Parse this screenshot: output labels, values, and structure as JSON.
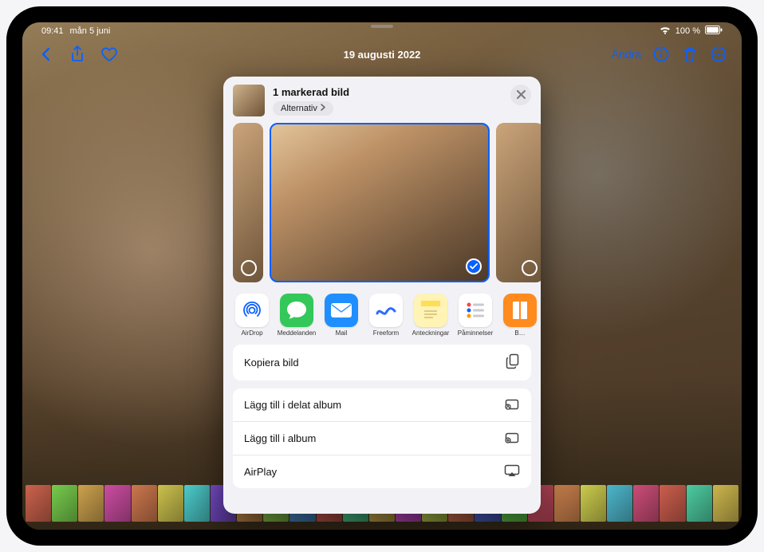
{
  "status": {
    "time": "09:41",
    "date": "mån 5 juni",
    "battery": "100 %"
  },
  "nav": {
    "title": "19 augusti 2022",
    "edit": "Ändra"
  },
  "sheet": {
    "title": "1 markerad bild",
    "options": "Alternativ",
    "apps": [
      {
        "label": "AirDrop",
        "bg": "#ffffff",
        "fg": "#0a60ff",
        "icon": "airdrop"
      },
      {
        "label": "Meddelanden",
        "bg": "#34c759",
        "fg": "#ffffff",
        "icon": "messages"
      },
      {
        "label": "Mail",
        "bg": "#1f8fff",
        "fg": "#ffffff",
        "icon": "mail"
      },
      {
        "label": "Freeform",
        "bg": "#ffffff",
        "fg": "#2b6cff",
        "icon": "freeform"
      },
      {
        "label": "Anteckningar",
        "bg": "#fff3b5",
        "fg": "#c7a13a",
        "icon": "notes"
      },
      {
        "label": "Påminnelser",
        "bg": "#ffffff",
        "fg": "#ff443a",
        "icon": "reminders"
      },
      {
        "label": "B…",
        "bg": "#ff8a1e",
        "fg": "#ffffff",
        "icon": "books"
      }
    ],
    "actions": {
      "copy": "Kopiera bild",
      "shared_album": "Lägg till i delat album",
      "album": "Lägg till i album",
      "airplay": "AirPlay"
    }
  }
}
